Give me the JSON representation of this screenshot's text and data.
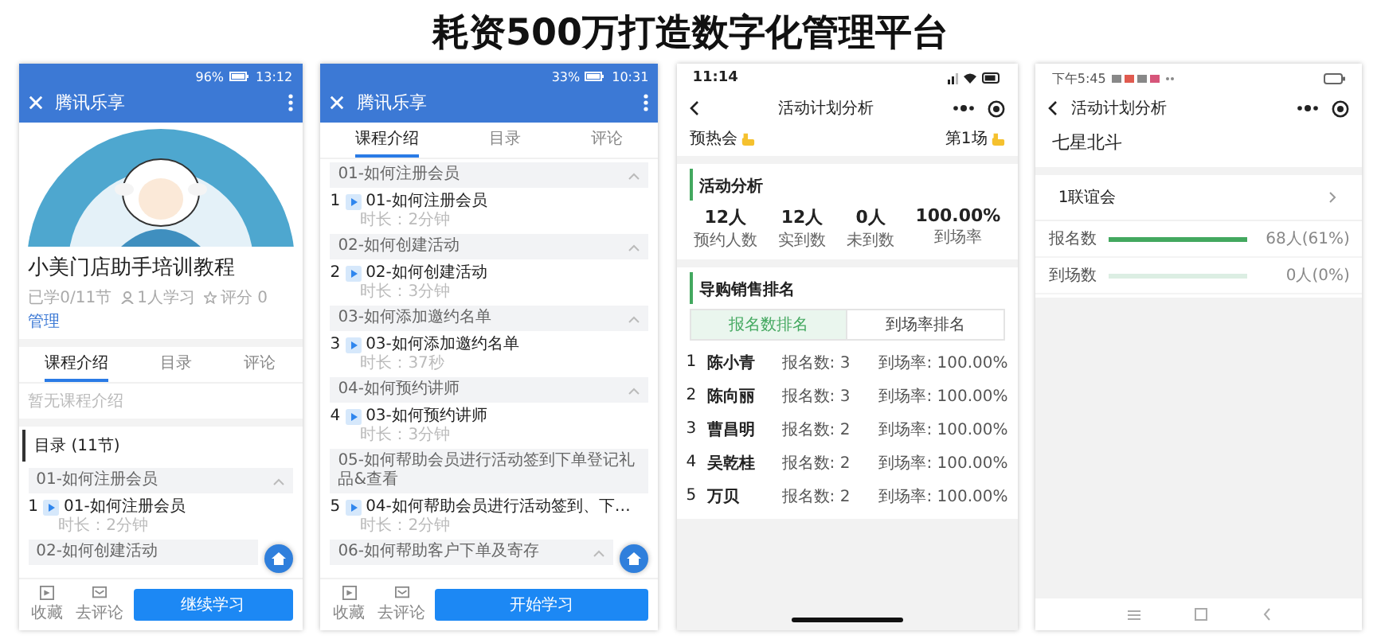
{
  "title": "耗资500万打造数字化管理平台",
  "phones": [
    {
      "kind": "course_intro",
      "status_bar": {
        "time": "13:12",
        "battery": "96%"
      },
      "header": {
        "title": "腾讯乐享"
      },
      "banner": {
        "kind": "picture"
      },
      "course_title": "小美门店助手培训教程",
      "meta": {
        "progress": "已学0/11节",
        "learners": "1人学习",
        "rating": "评分 0",
        "link": "管理"
      },
      "tabs": [
        {
          "label": "课程介绍",
          "selected": true
        },
        {
          "label": "目录",
          "selected": false
        },
        {
          "label": "评论",
          "selected": false
        }
      ],
      "intro": "暂无课程介绍",
      "catalog_heading": "目录 (11节)",
      "sections": [
        {
          "title": "01-如何注册会员",
          "expanded": true,
          "lessons": [
            {
              "number": "1",
              "title": "01-如何注册会员",
              "duration": "时长：2分钟"
            }
          ]
        },
        {
          "title": "02-如何创建活动"
        }
      ],
      "bottom_actions": [
        "收藏",
        "去评论"
      ],
      "primary_button": "继续学习"
    },
    {
      "kind": "course_catalog",
      "status_bar": {
        "time": "10:31",
        "battery": "33%"
      },
      "header": {
        "title": "腾讯乐享"
      },
      "tabs": [
        {
          "label": "课程介绍",
          "selected": true
        },
        {
          "label": "目录",
          "selected": false
        },
        {
          "label": "评论",
          "selected": false
        }
      ],
      "sections": [
        {
          "title": "01-如何注册会员",
          "expanded": true,
          "lessons": [
            {
              "number": "1",
              "title": "01-如何注册会员",
              "duration": "时长：2分钟"
            }
          ]
        },
        {
          "title": "02-如何创建活动",
          "expanded": true,
          "lessons": [
            {
              "number": "2",
              "title": "02-如何创建活动",
              "duration": "时长：3分钟"
            }
          ]
        },
        {
          "title": "03-如何添加邀约名单",
          "expanded": true,
          "lessons": [
            {
              "number": "3",
              "title": "03-如何添加邀约名单",
              "duration": "时长：37秒"
            }
          ]
        },
        {
          "title": "04-如何预约讲师",
          "expanded": true,
          "lessons": [
            {
              "number": "4",
              "title": "03-如何预约讲师",
              "duration": "时长：3分钟"
            }
          ]
        },
        {
          "title": "05-如何帮助会员进行活动签到下单登记礼品&查看",
          "lessons": [
            {
              "number": "5",
              "title": "04-如何帮助会员进行活动签到、下…",
              "duration": "时长：2分钟"
            }
          ]
        },
        {
          "title": "06-如何帮助客户下单及寄存",
          "expanded": true
        }
      ],
      "bottom_actions": [
        "收藏",
        "去评论"
      ],
      "primary_button": "开始学习"
    },
    {
      "kind": "activity_analysis",
      "status_bar": {
        "time": "11:14"
      },
      "nav_title": "活动计划分析",
      "event": "预热会",
      "session": "第1场",
      "analysis_heading": "活动分析",
      "stats": [
        {
          "value": "12人",
          "label": "预约人数"
        },
        {
          "value": "12人",
          "label": "实到数"
        },
        {
          "value": "0人",
          "label": "未到数"
        },
        {
          "value": "100.00%",
          "label": "到场率"
        }
      ],
      "ranking_heading": "导购销售排名",
      "ranking_tabs": [
        {
          "label": "报名数排名",
          "selected": true
        },
        {
          "label": "到场率排名",
          "selected": false
        }
      ],
      "ranking": [
        {
          "rank": "1",
          "name": "陈小青",
          "signups": "报名数: 3",
          "attendance": "到场率: 100.00%"
        },
        {
          "rank": "2",
          "name": "陈向丽",
          "signups": "报名数: 3",
          "attendance": "到场率: 100.00%"
        },
        {
          "rank": "3",
          "name": "曹昌明",
          "signups": "报名数: 2",
          "attendance": "到场率: 100.00%"
        },
        {
          "rank": "4",
          "name": "吴乾桂",
          "signups": "报名数: 2",
          "attendance": "到场率: 100.00%"
        },
        {
          "rank": "5",
          "name": "万贝",
          "signups": "报名数: 2",
          "attendance": "到场率: 100.00%"
        }
      ]
    },
    {
      "kind": "activity_summary",
      "status_bar": {
        "time": "下午5:45"
      },
      "nav_title": "活动计划分析",
      "team": "七星北斗",
      "event": "1联谊会",
      "bars": [
        {
          "label": "报名数",
          "level": 1,
          "value": "68人(61%)"
        },
        {
          "label": "到场数",
          "level": 0,
          "value": "0人(0%)"
        }
      ]
    }
  ]
}
